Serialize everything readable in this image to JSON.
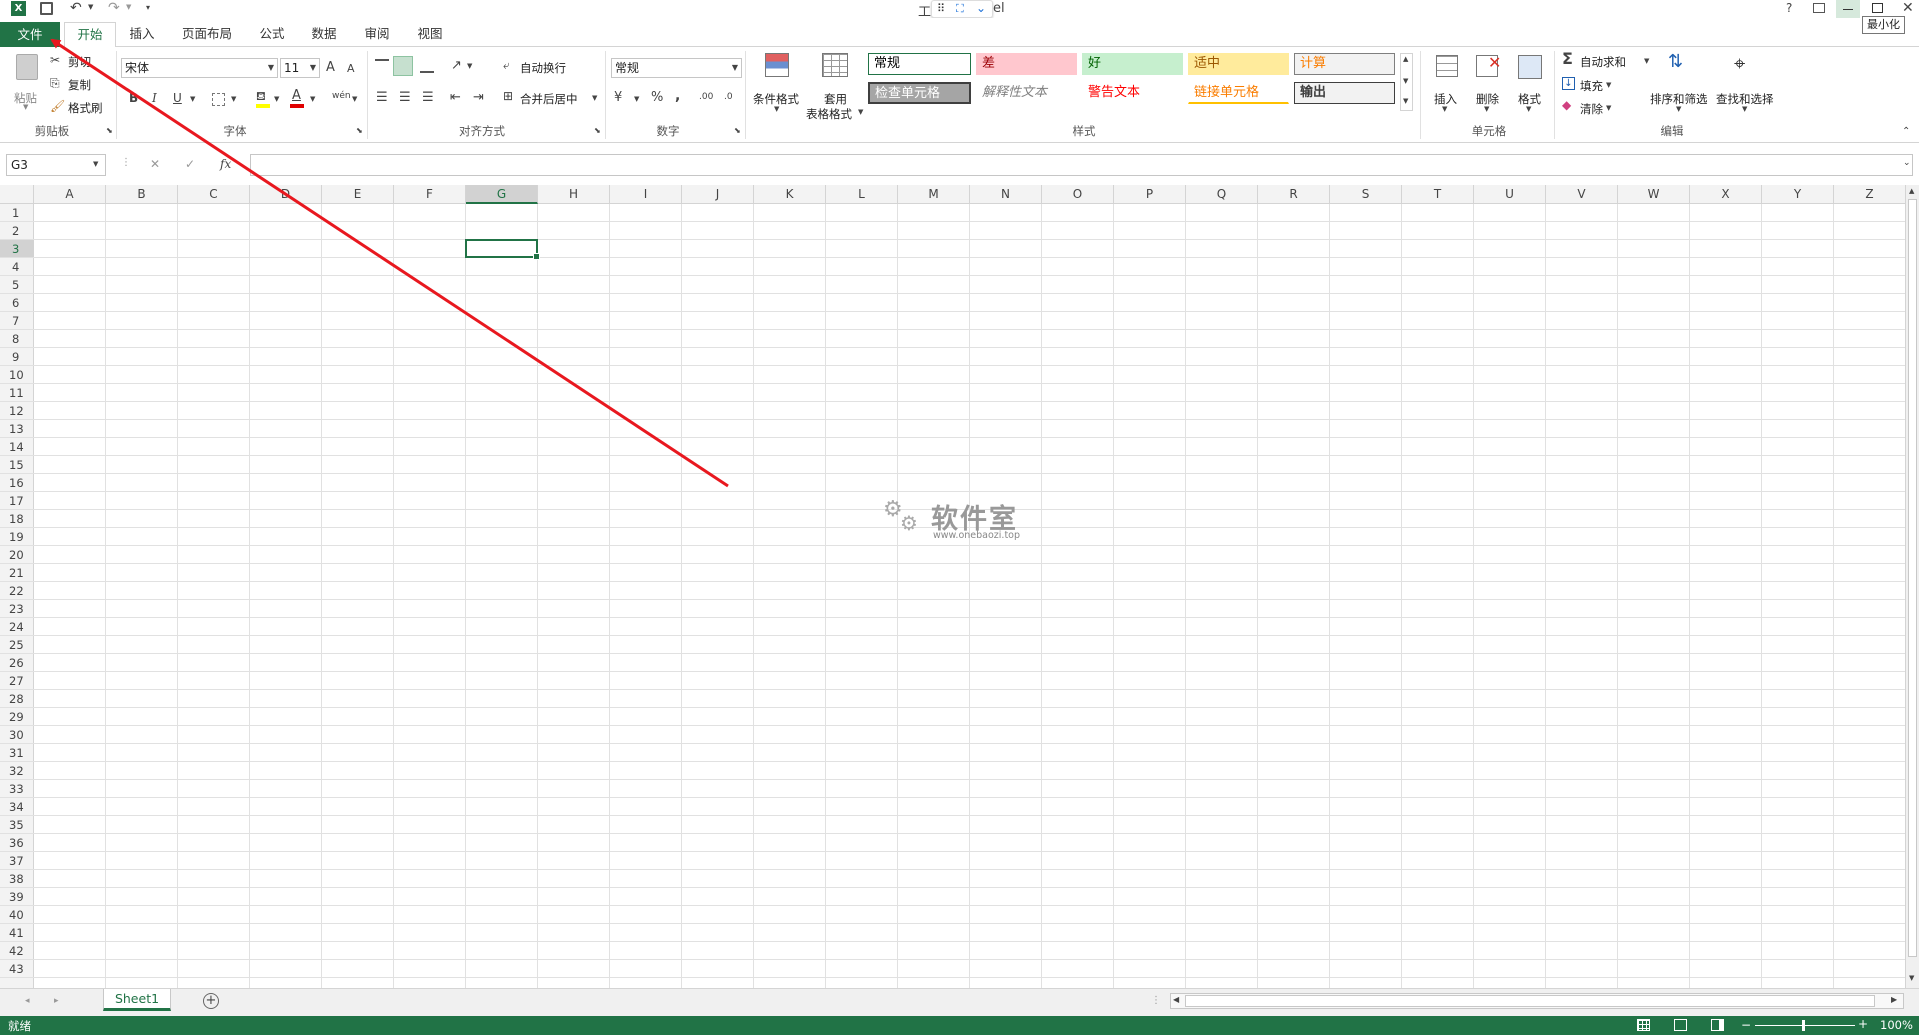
{
  "title_bar": {
    "app_icon": "excel-icon",
    "title_left": "工",
    "title_right": "el",
    "tooltip": "最小化",
    "controls": [
      "?",
      "restore",
      "minimize",
      "maximize",
      "close"
    ]
  },
  "tabs": {
    "file": "文件",
    "items": [
      "开始",
      "插入",
      "页面布局",
      "公式",
      "数据",
      "审阅",
      "视图"
    ],
    "active": "开始"
  },
  "clipboard": {
    "paste": "粘贴",
    "cut": "剪切",
    "copy": "复制",
    "format_painter": "格式刷",
    "label": "剪贴板"
  },
  "font": {
    "name": "宋体",
    "size": "11",
    "bold": "B",
    "italic": "I",
    "underline": "U",
    "grow": "A",
    "shrink": "A",
    "phonetic": "wén",
    "label": "字体"
  },
  "alignment": {
    "wrap": "自动换行",
    "merge": "合并后居中",
    "label": "对齐方式"
  },
  "number": {
    "format": "常规",
    "percent": "%",
    "comma": ",",
    "inc_decimal": ".00",
    "dec_decimal": ".0",
    "label": "数字"
  },
  "styles": {
    "conditional": "条件格式",
    "table1": "套用",
    "table2": "表格格式",
    "cells": [
      {
        "text": "常规",
        "fg": "#000000",
        "bg": "#ffffff",
        "border": "#217346"
      },
      {
        "text": "差",
        "fg": "#9c0006",
        "bg": "#ffc7ce",
        "border": "#ffc7ce"
      },
      {
        "text": "好",
        "fg": "#006100",
        "bg": "#c6efce",
        "border": "#c6efce"
      },
      {
        "text": "适中",
        "fg": "#9c5700",
        "bg": "#ffeb9c",
        "border": "#ffeb9c"
      },
      {
        "text": "计算",
        "fg": "#fa7d00",
        "bg": "#f2f2f2",
        "border": "#7f7f7f"
      },
      {
        "text": "检查单元格",
        "fg": "#ffffff",
        "bg": "#a5a5a5",
        "border": "#3f3f3f"
      },
      {
        "text": "解释性文本",
        "fg": "#7f7f7f",
        "bg": "#ffffff",
        "border": "#ffffff"
      },
      {
        "text": "警告文本",
        "fg": "#ff0000",
        "bg": "#ffffff",
        "border": "#ffffff"
      },
      {
        "text": "链接单元格",
        "fg": "#fa7d00",
        "bg": "#ffffff",
        "border": "#ffffff"
      },
      {
        "text": "输出",
        "fg": "#3f3f3f",
        "bg": "#f2f2f2",
        "border": "#3f3f3f"
      }
    ],
    "label": "样式"
  },
  "cells_group": {
    "insert": "插入",
    "delete": "删除",
    "format": "格式",
    "label": "单元格"
  },
  "editing": {
    "autosum": "自动求和",
    "fill": "填充",
    "clear": "清除",
    "sort": "排序和筛选",
    "find": "查找和选择",
    "label": "编辑"
  },
  "formula_bar": {
    "name_box": "G3",
    "cancel": "✕",
    "enter": "✓",
    "fx": "fx",
    "value": ""
  },
  "grid": {
    "columns": [
      "A",
      "B",
      "C",
      "D",
      "E",
      "F",
      "G",
      "H",
      "I",
      "J",
      "K",
      "L",
      "M",
      "N",
      "O",
      "P",
      "Q",
      "R",
      "S",
      "T",
      "U",
      "V",
      "W",
      "X",
      "Y",
      "Z"
    ],
    "rows": [
      "1",
      "2",
      "3",
      "4",
      "5",
      "6",
      "7",
      "8",
      "9",
      "10",
      "11",
      "12",
      "13",
      "14",
      "15",
      "16",
      "17",
      "18",
      "19",
      "20",
      "21",
      "22",
      "23",
      "24",
      "25",
      "26",
      "27",
      "28",
      "29",
      "30",
      "31",
      "32",
      "33",
      "34",
      "35",
      "36",
      "37",
      "38",
      "39",
      "40",
      "41",
      "42",
      "43"
    ],
    "active_col": "G",
    "active_row": "3"
  },
  "watermark": {
    "title": "软件室",
    "url": "www.onebaozi.top"
  },
  "sheet_tabs": {
    "active": "Sheet1",
    "add": "+"
  },
  "status_bar": {
    "ready": "就绪",
    "zoom": "100%"
  },
  "annotation": {
    "color": "#e8181f"
  }
}
